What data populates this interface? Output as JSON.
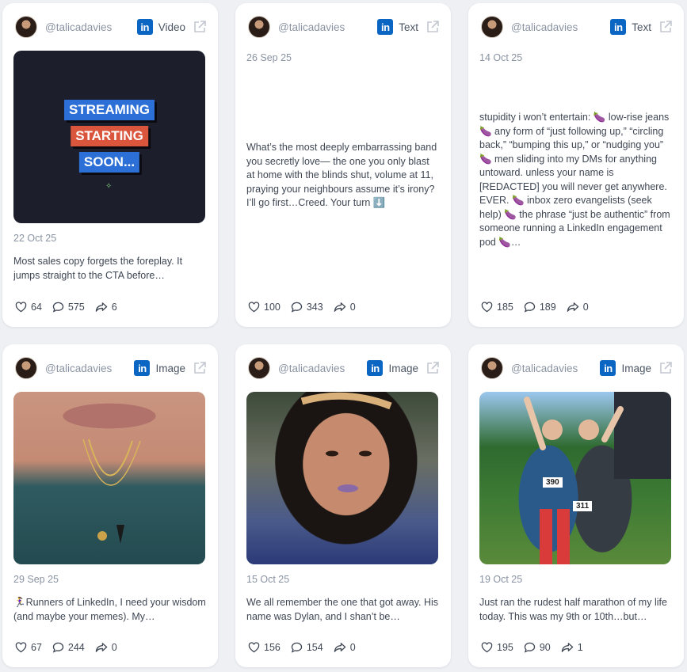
{
  "cards": [
    {
      "handle": "@talicadavies",
      "type": "Video",
      "date": "22 Oct 25",
      "snippet": "Most sales copy forgets the foreplay. It jumps straight to the CTA before…",
      "media": {
        "kind": "graphic",
        "lines": [
          "STREAMING",
          "STARTING",
          "SOON..."
        ],
        "spark": "✧"
      },
      "likes": "64",
      "comments": "575",
      "shares": "6"
    },
    {
      "handle": "@talicadavies",
      "type": "Text",
      "date": "26 Sep 25",
      "snippet": "What’s the most deeply embarrassing band you secretly love— the one you only blast at home with the blinds shut, volume at 11, praying your neighbours assume it’s irony? I’ll go first…Creed. Your turn ⬇️",
      "likes": "100",
      "comments": "343",
      "shares": "0"
    },
    {
      "handle": "@talicadavies",
      "type": "Text",
      "date": "14 Oct 25",
      "snippet": "stupidity i won’t entertain: 🍆 low-rise jeans 🍆 any form of “just following up,” “circling back,” “bumping this up,” or “nudging you” 🍆 men sliding into my DMs for anything untoward. unless your name is [REDACTED] you will never get anywhere. EVER. 🍆 inbox zero evangelists (seek help) 🍆 the phrase “just be authentic” from someone running a LinkedIn engagement pod 🍆…",
      "likes": "185",
      "comments": "189",
      "shares": "0"
    },
    {
      "handle": "@talicadavies",
      "type": "Image",
      "date": "29 Sep 25",
      "snippet": "🏃‍♀️Runners of LinkedIn, I need your wisdom (and maybe your memes). My…",
      "likes": "67",
      "comments": "244",
      "shares": "0"
    },
    {
      "handle": "@talicadavies",
      "type": "Image",
      "date": "15 Oct 25",
      "snippet": "We all remember the one that got away. His name was Dylan, and I shan’t be…",
      "likes": "156",
      "comments": "154",
      "shares": "0"
    },
    {
      "handle": "@talicadavies",
      "type": "Image",
      "date": "19 Oct 25",
      "snippet": "Just ran the rudest half marathon of my life today. This was my 9th or 10th…but…",
      "media": {
        "bibs": [
          "390",
          "311"
        ]
      },
      "likes": "195",
      "comments": "90",
      "shares": "1"
    }
  ],
  "icons": {
    "network": "linkedin-icon",
    "open": "external-link-icon",
    "likes": "heart-icon",
    "comments": "comment-icon",
    "shares": "share-icon"
  },
  "colors": {
    "background": "#eef0f4",
    "card": "#ffffff",
    "linkedin": "#0a66c2",
    "muted": "#8a93a2",
    "text": "#3f4754"
  }
}
